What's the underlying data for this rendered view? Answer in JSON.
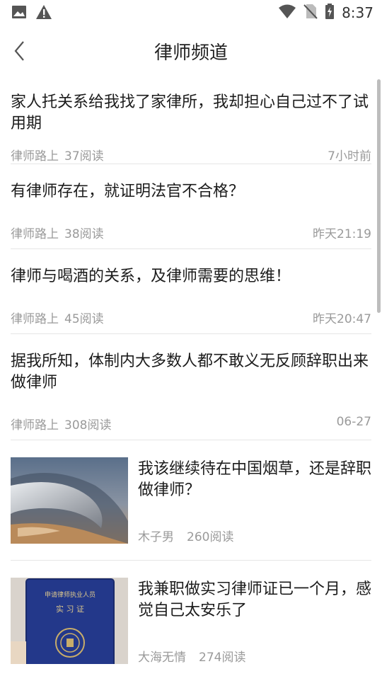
{
  "status_bar": {
    "time": "8:37"
  },
  "header": {
    "title": "律师频道"
  },
  "articles": [
    {
      "title": "家人托关系给我找了家律所，我却担心自己过不了试用期",
      "author": "律师路上",
      "reads": "37阅读",
      "time": "7小时前"
    },
    {
      "title": "有律师存在，就证明法官不合格？",
      "author": "律师路上",
      "reads": "38阅读",
      "time": "昨天21:19"
    },
    {
      "title": "律师与喝酒的关系，及律师需要的思维！",
      "author": "律师路上",
      "reads": "45阅读",
      "time": "昨天20:47"
    },
    {
      "title": "据我所知，体制内大多数人都不敢义无反顾辞职出来做律师",
      "author": "律师路上",
      "reads": "308阅读",
      "time": "06-27"
    },
    {
      "title": "我该继续待在中国烟草，还是辞职做律师？",
      "author": "木子男",
      "reads": "260阅读",
      "thumb": "storm-cloud-photo"
    },
    {
      "title": "我兼职做实习律师证已一个月，感觉自己太安乐了",
      "author": "大海无情",
      "reads": "274阅读",
      "thumb": "certificate-photo",
      "thumb_text": {
        "line1": "申请律师执业人员",
        "line2": "实 习 证"
      }
    }
  ]
}
